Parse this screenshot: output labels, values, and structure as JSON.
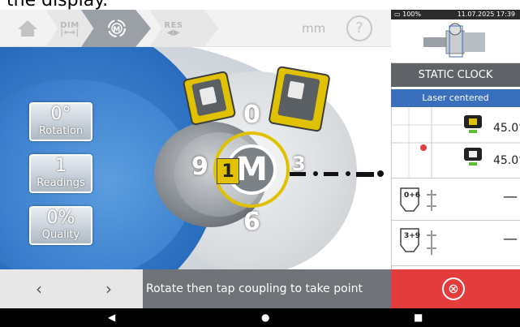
{
  "caption": "the display.",
  "toolbar": {
    "home_icon": "home-icon",
    "steps": [
      {
        "label": "DIM",
        "icon": "dimensions-icon"
      },
      {
        "label": "M",
        "icon": "measure-icon"
      },
      {
        "label": "RES",
        "icon": "results-icon"
      }
    ],
    "units": "mm",
    "help": "?"
  },
  "scene": {
    "metrics": [
      {
        "value": "0°",
        "label": "Rotation"
      },
      {
        "value": "1",
        "label": "Readings"
      },
      {
        "value": "0%",
        "label": "Quality"
      }
    ],
    "reading_number": "1",
    "center_button": "M",
    "clock_positions": [
      "0",
      "3",
      "6",
      "9"
    ]
  },
  "status_bar": {
    "battery": "100%",
    "date_time": "11.07.2025 17:39"
  },
  "right_panel": {
    "title": "STATIC CLOCK",
    "laser_status": "Laser centered",
    "sensor_angles": [
      "45.0°",
      "45.0°"
    ],
    "positions": [
      {
        "label": "0+6",
        "value": "—"
      },
      {
        "label": "3+9",
        "value": "—"
      }
    ]
  },
  "bottom": {
    "prev": "‹",
    "next": "›",
    "message": "Rotate then tap coupling to take point",
    "cancel": "⊗"
  },
  "colors": {
    "accent_blue": "#3a6fbd",
    "cancel_red": "#e23c3c",
    "sensor_yellow": "#e1c200",
    "panel_gray": "#5f6368"
  }
}
